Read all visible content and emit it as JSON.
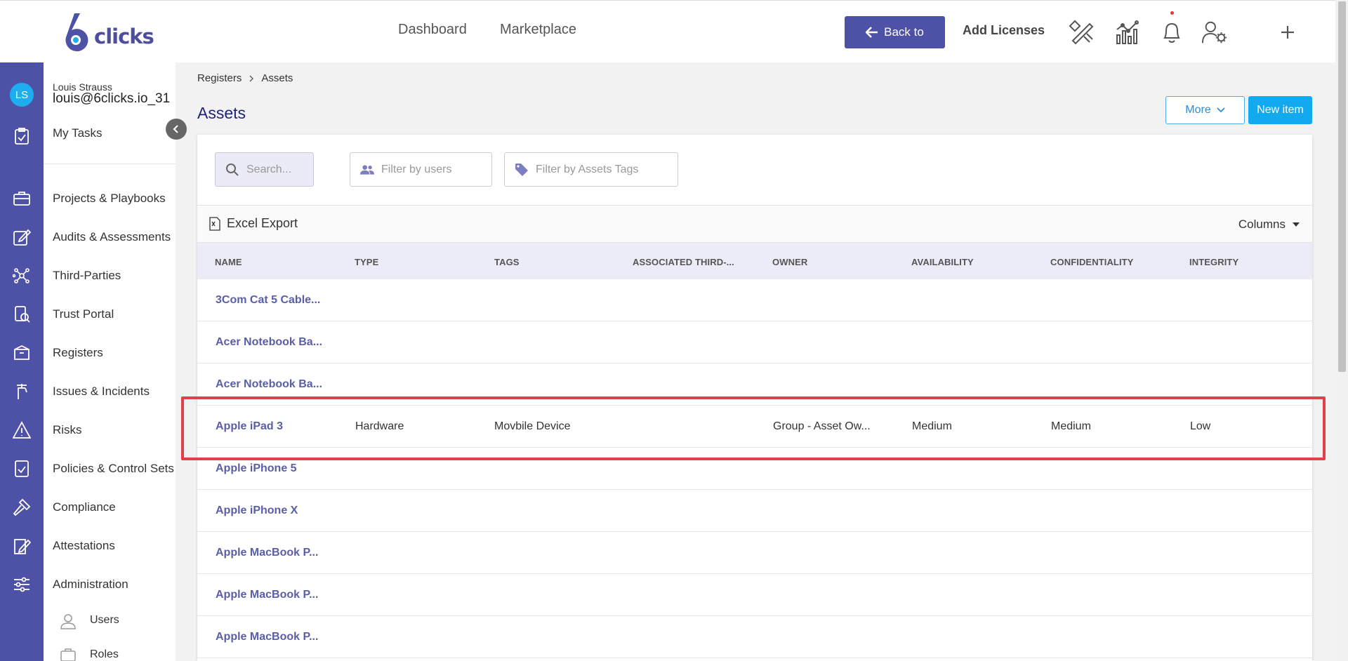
{
  "header": {
    "logo_text": "clicks",
    "nav": [
      "Dashboard",
      "Marketplace"
    ],
    "back_button": "Back to",
    "add_licenses": "Add Licenses",
    "icons": [
      "design-icon",
      "analytics-icon",
      "bell-icon",
      "user-settings-icon",
      "plus-icon"
    ]
  },
  "user": {
    "initials": "LS",
    "name": "Louis Strauss",
    "email": "louis@6clicks.io_31"
  },
  "sidebar": {
    "my_tasks": "My Tasks",
    "items": [
      "Projects & Playbooks",
      "Audits & Assessments",
      "Third-Parties",
      "Trust Portal",
      "Registers",
      "Issues & Incidents",
      "Risks",
      "Policies & Control Sets",
      "Compliance",
      "Attestations",
      "Administration"
    ],
    "subitems": [
      "Users",
      "Roles"
    ]
  },
  "breadcrumb": [
    "Registers",
    "Assets"
  ],
  "page": {
    "title": "Assets",
    "more_button": "More",
    "new_button": "New item"
  },
  "filters": {
    "search_placeholder": "Search...",
    "users_placeholder": "Filter by users",
    "tags_placeholder": "Filter by Assets Tags"
  },
  "toolbar": {
    "excel_export": "Excel Export",
    "columns": "Columns"
  },
  "table": {
    "headers": [
      "NAME",
      "TYPE",
      "TAGS",
      "ASSOCIATED THIRD-...",
      "OWNER",
      "AVAILABILITY",
      "CONFIDENTIALITY",
      "INTEGRITY"
    ],
    "rows": [
      {
        "name": "3Com Cat 5 Cable...",
        "type": "",
        "tags": "",
        "third": "",
        "owner": "",
        "availability": "",
        "confidentiality": "",
        "integrity": ""
      },
      {
        "name": "Acer Notebook Ba...",
        "type": "",
        "tags": "",
        "third": "",
        "owner": "",
        "availability": "",
        "confidentiality": "",
        "integrity": ""
      },
      {
        "name": "Acer Notebook Ba...",
        "type": "",
        "tags": "",
        "third": "",
        "owner": "",
        "availability": "",
        "confidentiality": "",
        "integrity": ""
      },
      {
        "name": "Apple iPad 3",
        "type": "Hardware",
        "tags": "Movbile Device",
        "third": "",
        "owner": "Group - Asset Ow...",
        "availability": "Medium",
        "confidentiality": "Medium",
        "integrity": "Low"
      },
      {
        "name": "Apple iPhone 5",
        "type": "",
        "tags": "",
        "third": "",
        "owner": "",
        "availability": "",
        "confidentiality": "",
        "integrity": ""
      },
      {
        "name": "Apple iPhone X",
        "type": "",
        "tags": "",
        "third": "",
        "owner": "",
        "availability": "",
        "confidentiality": "",
        "integrity": ""
      },
      {
        "name": "Apple MacBook P...",
        "type": "",
        "tags": "",
        "third": "",
        "owner": "",
        "availability": "",
        "confidentiality": "",
        "integrity": ""
      },
      {
        "name": "Apple MacBook P...",
        "type": "",
        "tags": "",
        "third": "",
        "owner": "",
        "availability": "",
        "confidentiality": "",
        "integrity": ""
      },
      {
        "name": "Apple MacBook P...",
        "type": "",
        "tags": "",
        "third": "",
        "owner": "",
        "availability": "",
        "confidentiality": "",
        "integrity": ""
      }
    ]
  },
  "colors": {
    "brand": "#4e52a6",
    "accent": "#13a9ef",
    "highlight": "#e04048"
  }
}
